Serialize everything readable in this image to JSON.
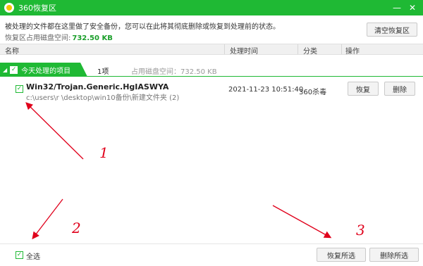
{
  "window": {
    "title": "360恢复区",
    "minimize_glyph": "—",
    "close_glyph": "✕"
  },
  "info": {
    "description": "被处理的文件都在这里做了安全备份，您可以在此将其彻底删除或恢复到处理前的状态。",
    "space_label": "恢复区占用磁盘空间:",
    "space_value": "732.50 KB",
    "clear_button": "清空恢复区"
  },
  "columns": {
    "name": "名称",
    "time": "处理时间",
    "category": "分类",
    "action": "操作"
  },
  "group": {
    "label": "今天处理的项目",
    "count": "1项",
    "space_text": "占用磁盘空间：732.50 KB",
    "checked": true
  },
  "items": [
    {
      "name": "Win32/Trojan.Generic.HgIASWYA",
      "path": "c:\\users\\r              \\desktop\\win10备份\\新建文件夹 (2)",
      "time": "2021-11-23 10:51:40",
      "category": "360杀毒",
      "restore_label": "恢复",
      "delete_label": "删除",
      "checked": true
    }
  ],
  "footer": {
    "select_all": "全选",
    "restore_selected": "恢复所选",
    "delete_selected": "删除所选"
  },
  "annotations": {
    "numbers": [
      "1",
      "2",
      "3"
    ],
    "color": "#e0001b"
  },
  "colors": {
    "accent": "#1fb934",
    "size_highlight": "#1a9e2a"
  }
}
